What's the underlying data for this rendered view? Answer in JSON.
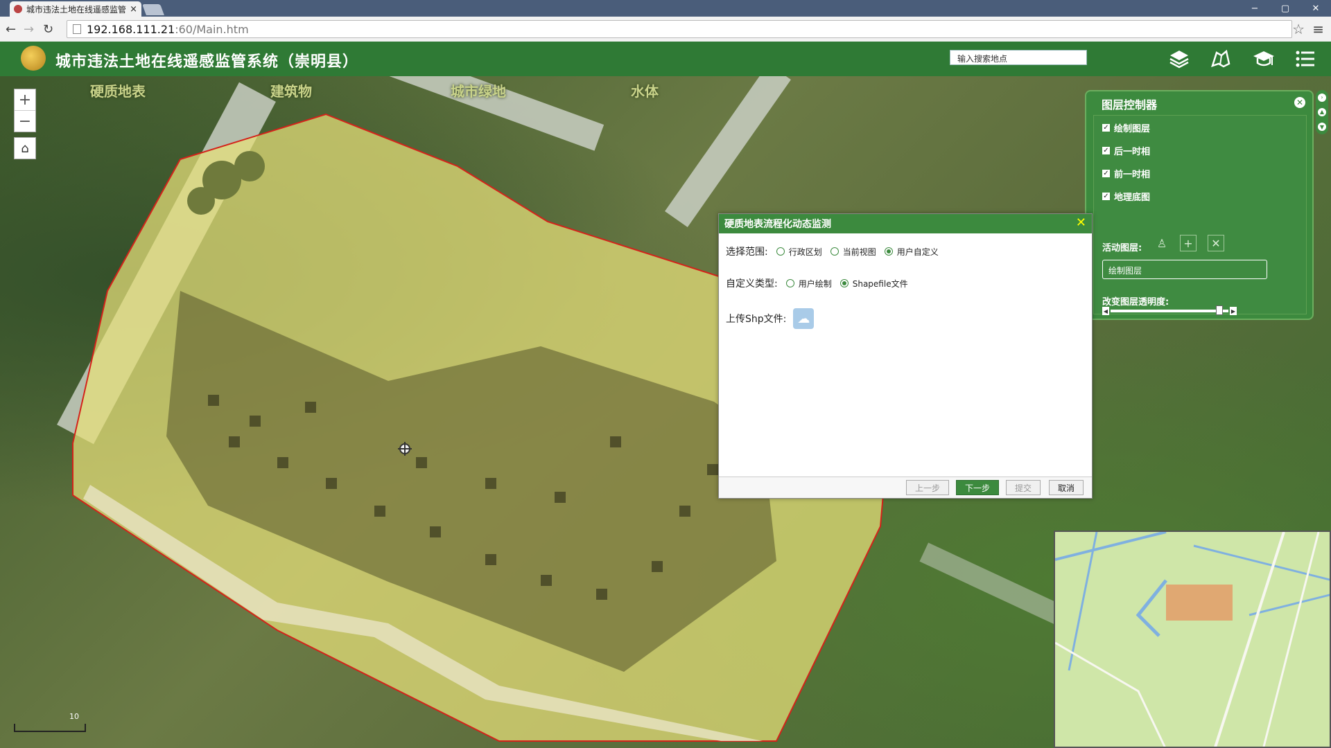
{
  "browser": {
    "tab_title": "城市违法土地在线遥感监管",
    "tab_close": "×",
    "url_host": "192.168.111.21",
    "url_path": ":60/Main.htm",
    "window_controls": [
      "−",
      "▢",
      "✕"
    ]
  },
  "header": {
    "title": "城市违法土地在线遥感监管系统（崇明县）",
    "search_placeholder": "输入搜索地点",
    "icons": [
      "layers-icon",
      "map-tool-icon",
      "graduation-cap-icon",
      "list-menu-icon"
    ]
  },
  "map": {
    "categories": [
      "硬质地表",
      "建筑物",
      "城市绿地",
      "水体"
    ],
    "zoom_in": "+",
    "zoom_out": "−",
    "home": "⌂",
    "scale_label": "10"
  },
  "layer_panel": {
    "title": "图层控制器",
    "close": "✕",
    "layers": [
      {
        "label": "绘制图层",
        "checked": true
      },
      {
        "label": "后一时相",
        "checked": true
      },
      {
        "label": "前一时相",
        "checked": true
      },
      {
        "label": "地理底图",
        "checked": true
      }
    ],
    "check_mark": "✓",
    "active_layer_label": "活动图层:",
    "active_layer_value": "绘制图层",
    "opacity_label": "改变图层透明度:",
    "opacity_value": 0.95
  },
  "dialog": {
    "title": "硬质地表流程化动态监测",
    "close": "✕",
    "scope_label": "选择范围:",
    "scope_options": [
      "行政区划",
      "当前视图",
      "用户自定义"
    ],
    "scope_selected": 2,
    "type_label": "自定义类型:",
    "type_options": [
      "用户绘制",
      "Shapefile文件"
    ],
    "type_selected": 1,
    "upload_label": "上传Shp文件:",
    "buttons": {
      "prev": "上一步",
      "next": "下一步",
      "submit": "提交",
      "cancel": "取消"
    }
  },
  "colors": {
    "header_green": "#2f7a35",
    "panel_green": "#3c8a3e",
    "boundary_red": "#d4221a",
    "site_yellow": "#e8e07a"
  }
}
